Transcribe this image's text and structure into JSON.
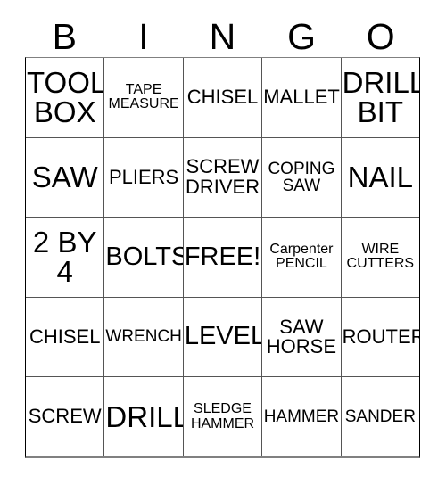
{
  "header": {
    "letters": [
      "B",
      "I",
      "N",
      "G",
      "O"
    ]
  },
  "grid": {
    "rows": [
      [
        {
          "text": "TOOL\nBOX",
          "size": "sz-xl"
        },
        {
          "text": "TAPE\nMEASURE",
          "size": "sz-xs"
        },
        {
          "text": "CHISEL",
          "size": "sz-md"
        },
        {
          "text": "MALLET",
          "size": "sz-md"
        },
        {
          "text": "DRILL\nBIT",
          "size": "sz-xl"
        }
      ],
      [
        {
          "text": "SAW",
          "size": "sz-xl"
        },
        {
          "text": "PLIERS",
          "size": "sz-md"
        },
        {
          "text": "SCREW\nDRIVER",
          "size": "sz-md"
        },
        {
          "text": "COPING\nSAW",
          "size": "sz-sm"
        },
        {
          "text": "NAIL",
          "size": "sz-xl"
        }
      ],
      [
        {
          "text": "2 BY\n4",
          "size": "sz-xl"
        },
        {
          "text": "BOLTS",
          "size": "sz-lg"
        },
        {
          "text": "FREE!",
          "size": "sz-lg"
        },
        {
          "text": "Carpenter\nPENCIL",
          "size": "sz-xs"
        },
        {
          "text": "WIRE\nCUTTERS",
          "size": "sz-xs"
        }
      ],
      [
        {
          "text": "CHISEL",
          "size": "sz-md"
        },
        {
          "text": "WRENCH",
          "size": "sz-sm"
        },
        {
          "text": "LEVEL",
          "size": "sz-lg"
        },
        {
          "text": "SAW\nHORSE",
          "size": "sz-md"
        },
        {
          "text": "ROUTER",
          "size": "sz-md"
        }
      ],
      [
        {
          "text": "SCREW",
          "size": "sz-md"
        },
        {
          "text": "DRILL",
          "size": "sz-xl"
        },
        {
          "text": "SLEDGE\nHAMMER",
          "size": "sz-xs"
        },
        {
          "text": "HAMMER",
          "size": "sz-sm"
        },
        {
          "text": "SANDER",
          "size": "sz-sm"
        }
      ]
    ]
  }
}
